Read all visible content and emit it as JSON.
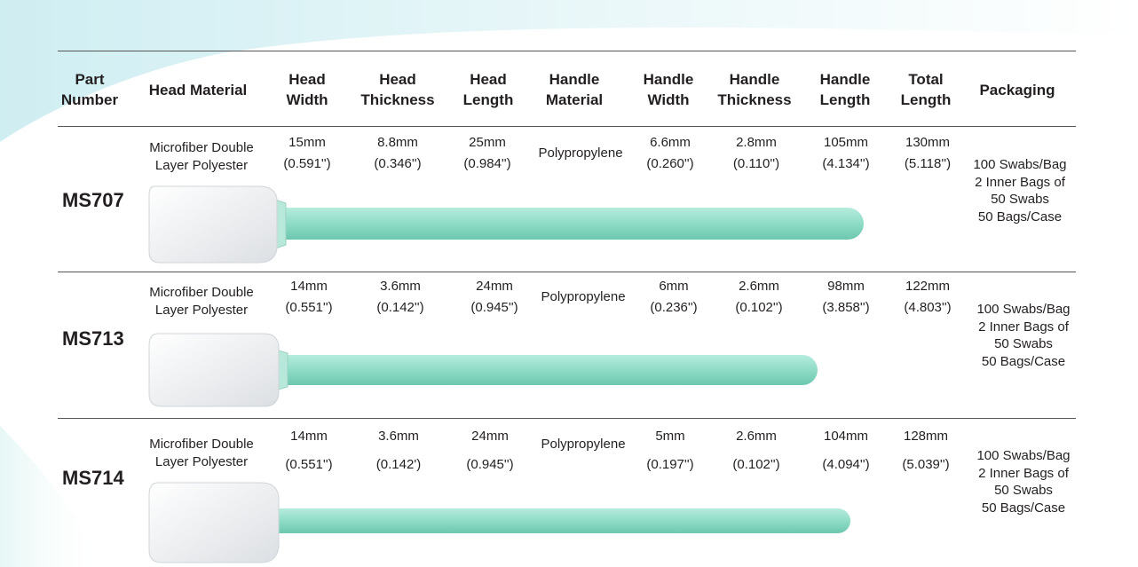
{
  "headers": {
    "part_number": [
      "Part",
      "Number"
    ],
    "head_material": "Head Material",
    "head_width": [
      "Head",
      "Width"
    ],
    "head_thickness": [
      "Head",
      "Thickness"
    ],
    "head_length": [
      "Head",
      "Length"
    ],
    "handle_material": [
      "Handle",
      "Material"
    ],
    "handle_width": [
      "Handle",
      "Width"
    ],
    "handle_thickness": [
      "Handle",
      "Thickness"
    ],
    "handle_length": [
      "Handle",
      "Length"
    ],
    "total_length": [
      "Total",
      "Length"
    ],
    "packaging": "Packaging"
  },
  "rows": [
    {
      "part_number": "MS707",
      "head_material": [
        "Microfiber Double",
        "Layer Polyester"
      ],
      "head_width": [
        "15mm",
        "(0.591'')"
      ],
      "head_thickness": [
        "8.8mm",
        "(0.346'')"
      ],
      "head_length": [
        "25mm",
        "(0.984'')"
      ],
      "handle_material": "Polypropylene",
      "handle_width": [
        "6.6mm",
        "(0.260'')"
      ],
      "handle_thickness": [
        "2.8mm",
        "(0.110'')"
      ],
      "handle_length": [
        "105mm",
        "(4.134'')"
      ],
      "total_length": [
        "130mm",
        "(5.118'')"
      ],
      "packaging": [
        "100 Swabs/Bag",
        "2 Inner Bags of",
        "50 Swabs",
        "50 Bags/Case"
      ]
    },
    {
      "part_number": "MS713",
      "head_material": [
        "Microfiber Double",
        "Layer Polyester"
      ],
      "head_width": [
        "14mm",
        "(0.551'')"
      ],
      "head_thickness": [
        "3.6mm",
        "(0.142'')"
      ],
      "head_length": [
        "24mm",
        "(0.945'')"
      ],
      "handle_material": "Polypropylene",
      "handle_width": [
        "6mm",
        "(0.236'')"
      ],
      "handle_thickness": [
        "2.6mm",
        "(0.102'')"
      ],
      "handle_length": [
        "98mm",
        "(3.858'')"
      ],
      "total_length": [
        "122mm",
        "(4.803'')"
      ],
      "packaging": [
        "100 Swabs/Bag",
        "2 Inner Bags of",
        "50 Swabs",
        "50 Bags/Case"
      ]
    },
    {
      "part_number": "MS714",
      "head_material": [
        "Microfiber Double",
        "Layer Polyester"
      ],
      "head_width": [
        "14mm",
        "(0.551'')"
      ],
      "head_thickness": [
        "3.6mm",
        "(0.142')"
      ],
      "head_length": [
        "24mm",
        "(0.945'')"
      ],
      "handle_material": "Polypropylene",
      "handle_width": [
        "5mm",
        "(0.197'')"
      ],
      "handle_thickness": [
        "2.6mm",
        "(0.102'')"
      ],
      "handle_length": [
        "104mm",
        "(4.094'')"
      ],
      "total_length": [
        "128mm",
        "(5.039'')"
      ],
      "packaging": [
        "100 Swabs/Bag",
        "2 Inner Bags of",
        "50 Swabs",
        "50 Bags/Case"
      ]
    }
  ],
  "colors": {
    "handle": "#8fdcc6",
    "head": "#f3f4f6",
    "rule": "#555555",
    "text": "#231f20"
  }
}
